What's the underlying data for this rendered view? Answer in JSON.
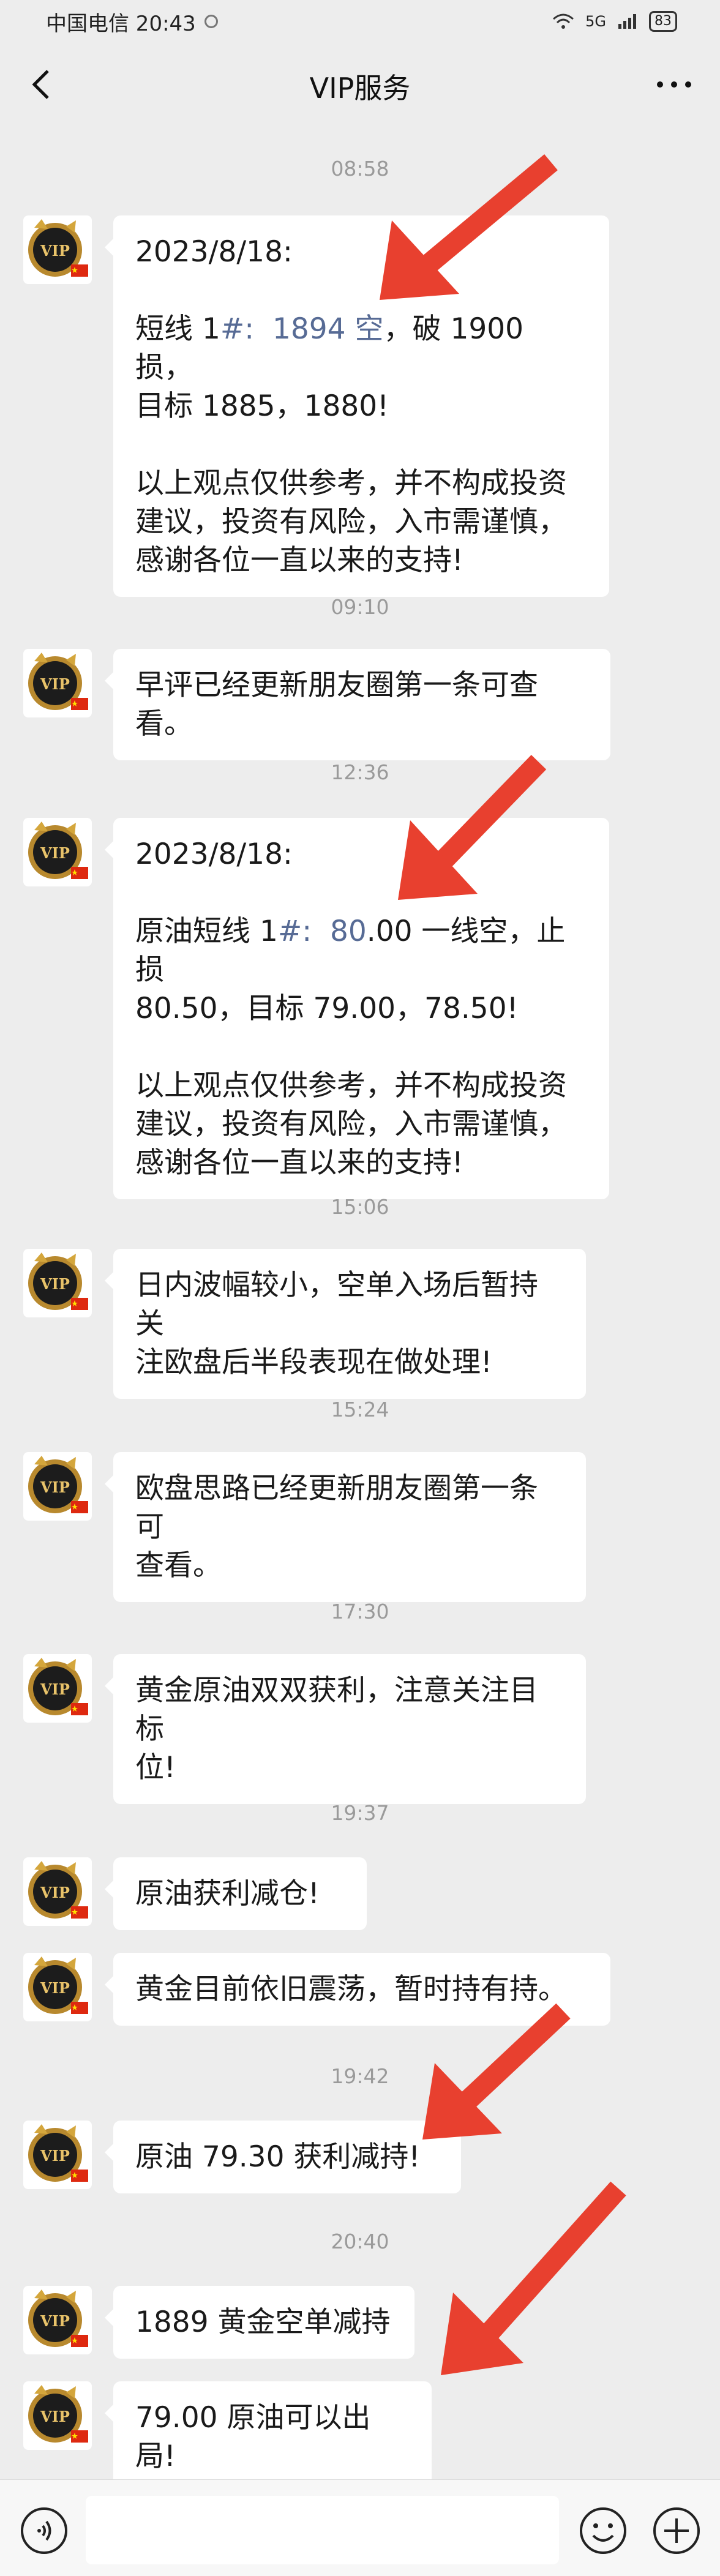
{
  "status_bar": {
    "carrier_time": "中国电信 20:43",
    "network": "5G",
    "battery": "83"
  },
  "nav": {
    "title": "VIP服务",
    "back_icon": "chevron-left-icon",
    "more_icon": "more-dots-icon"
  },
  "messages": [
    {
      "time": "08:58",
      "pre": "2023/8/18:\n\n短线 1",
      "hl": "#:  1894 空",
      "post": "，破 1900 损，\n目标 1885，1880!\n\n以上观点仅供参考，并不构成投资\n建议，投资有风险，入市需谨慎，\n感谢各位一直以来的支持!"
    },
    {
      "time": "09:10",
      "pre": "早评已经更新朋友圈第一条可查看。",
      "hl": "",
      "post": ""
    },
    {
      "time": "12:36",
      "pre": "2023/8/18:\n\n原油短线 1",
      "hl": "#:  80",
      "post": ".00 一线空，止损\n80.50，目标 79.00，78.50!\n\n以上观点仅供参考，并不构成投资\n建议，投资有风险，入市需谨慎，\n感谢各位一直以来的支持!"
    },
    {
      "time": "15:06",
      "pre": "日内波幅较小，空单入场后暂持关\n注欧盘后半段表现在做处理!",
      "hl": "",
      "post": ""
    },
    {
      "time": "15:24",
      "pre": "欧盘思路已经更新朋友圈第一条可\n查看。",
      "hl": "",
      "post": ""
    },
    {
      "time": "17:30",
      "pre": "黄金原油双双获利，注意关注目标\n位!",
      "hl": "",
      "post": ""
    },
    {
      "time": "19:37",
      "pre": "原油获利减仓!",
      "hl": "",
      "post": ""
    },
    {
      "time": "",
      "pre": "黄金目前依旧震荡，暂时持有持。",
      "hl": "",
      "post": ""
    },
    {
      "time": "19:42",
      "pre": "原油 79.30 获利减持!",
      "hl": "",
      "post": ""
    },
    {
      "time": "20:40",
      "pre": "1889 黄金空单减持",
      "hl": "",
      "post": ""
    },
    {
      "time": "",
      "pre": "79.00 原油可以出局!",
      "hl": "",
      "post": ""
    }
  ],
  "avatar": {
    "text": "VIP",
    "icon": "vip-avatar-icon"
  },
  "input_bar": {
    "voice_icon": "voice-icon",
    "emoji_icon": "emoji-icon",
    "plus_icon": "plus-icon"
  },
  "colors": {
    "accent_link": "#576b95",
    "arrow": "#e8402f",
    "bg": "#ededed"
  }
}
